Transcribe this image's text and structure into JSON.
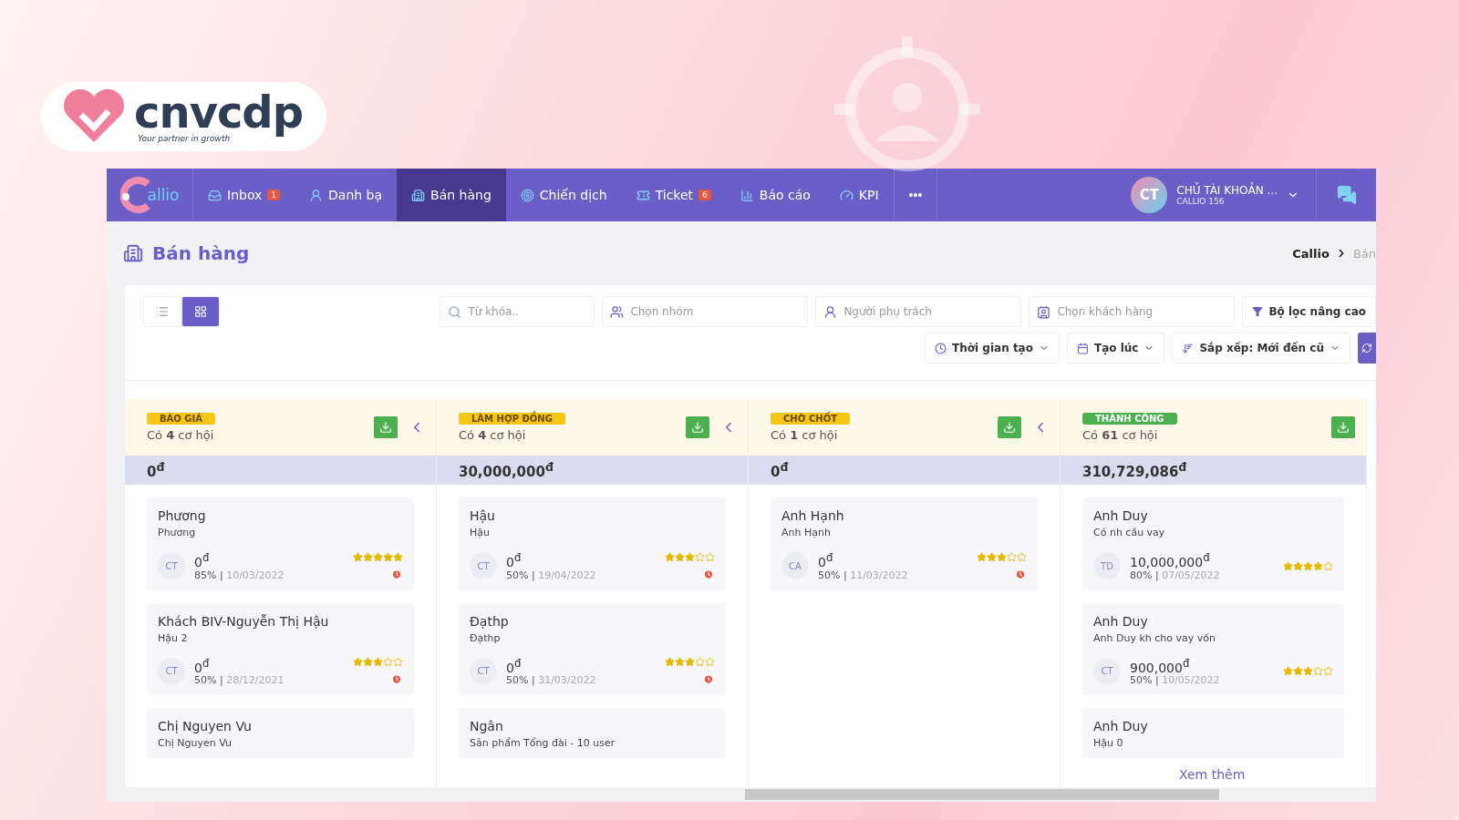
{
  "brand": {
    "name": "cnvcdp",
    "tagline": "Your partner in growth"
  },
  "nav": {
    "logo": "allio",
    "items": [
      {
        "label": "Inbox",
        "badge": "1",
        "selected": false
      },
      {
        "label": "Danh bạ",
        "selected": false
      },
      {
        "label": "Bán hàng",
        "selected": true
      },
      {
        "label": "Chiến dịch",
        "selected": false
      },
      {
        "label": "Ticket",
        "badge": "6",
        "selected": false
      },
      {
        "label": "Báo cáo",
        "selected": false
      },
      {
        "label": "KPI",
        "selected": false
      }
    ],
    "more": "•••",
    "user": {
      "initials": "CT",
      "name": "CHỦ TÀI KHOẢN ...",
      "account": "CALLIO 156"
    }
  },
  "page": {
    "title": "Bán hàng",
    "breadcrumb": [
      "Callio",
      "Bán"
    ]
  },
  "views": [
    {
      "kind": "list",
      "selected": false
    },
    {
      "kind": "board",
      "selected": true
    }
  ],
  "filters": {
    "search": {
      "placeholder": "Từ khóa.."
    },
    "group": {
      "placeholder": "Chọn nhóm"
    },
    "owner": {
      "placeholder": "Người phụ trách"
    },
    "customer": {
      "placeholder": "Chọn khách hàng"
    },
    "advanced": "Bộ lọc nâng cao",
    "dropdowns": [
      {
        "kind": "clock",
        "label": "Thời gian tạo"
      },
      {
        "kind": "calendar",
        "label": "Tạo lúc"
      },
      {
        "kind": "sort",
        "label": "Sắp xếp: Mới đến cũ"
      }
    ]
  },
  "columns": [
    {
      "stage": "BÁO GIÁ",
      "color": "#f5c518",
      "count": "Có **4** cơ hội",
      "total": "0$^{đ}$",
      "collapsible": true,
      "cards": [
        {
          "title": "Phương",
          "subtitle": "Phương",
          "avatar": "CT",
          "amount": "0$^{đ}$",
          "meta": "85% | ",
          "date": "10/03/2022",
          "stars": 5,
          "overdue": true
        },
        {
          "title": "Khách BIV-Nguyễn Thị Hậu",
          "subtitle": "Hậu 2",
          "avatar": "CT",
          "amount": "0$^{đ}$",
          "meta": "50% | ",
          "date": "28/12/2021",
          "stars": 3,
          "overdue": true
        },
        {
          "title": "Chị Nguyen Vu",
          "subtitle": "Chị Nguyen Vu"
        }
      ]
    },
    {
      "stage": "LÀM HỢP ĐỒNG",
      "color": "#f5c518",
      "count": "Có **4** cơ hội",
      "total": "30,000,000$^{đ}$",
      "collapsible": true,
      "cards": [
        {
          "title": "Hậu",
          "subtitle": "Hậu",
          "avatar": "CT",
          "amount": "0$^{đ}$",
          "meta": "50% | ",
          "date": "19/04/2022",
          "stars": 3,
          "overdue": true
        },
        {
          "title": "Đạthp",
          "subtitle": "Đạthp",
          "avatar": "CT",
          "amount": "0$^{đ}$",
          "meta": "50% | ",
          "date": "31/03/2022",
          "stars": 3,
          "overdue": true
        },
        {
          "title": "Ngân",
          "subtitle": "Sản phẩm Tổng đài - 10 user"
        }
      ]
    },
    {
      "stage": "CHỜ CHỐT",
      "color": "#f5c518",
      "count": "Có **1** cơ hội",
      "total": "0$^{đ}$",
      "collapsible": true,
      "cards": [
        {
          "title": "Anh Hạnh",
          "subtitle": "Anh Hạnh",
          "avatar": "CA",
          "amount": "0$^{đ}$",
          "meta": "50% | ",
          "date": "11/03/2022",
          "stars": 3,
          "overdue": true
        }
      ]
    },
    {
      "stage": "THÀNH CÔNG",
      "color": "#4caf50",
      "count": "Có **61** cơ hội",
      "total": "310,729,086$^{đ}$",
      "collapsible": false,
      "more": "Xem thêm",
      "cards": [
        {
          "title": "Anh Duy",
          "subtitle": "Có nh cầu vay",
          "avatar": "TD",
          "amount": "10,000,000$^{đ}$",
          "meta": "80% | ",
          "date": "07/05/2022",
          "stars": 4,
          "overdue": false
        },
        {
          "title": "Anh Duy",
          "subtitle": "Anh Duy kh cho vay vốn",
          "avatar": "CT",
          "amount": "900,000$^{đ}$",
          "meta": "50% | ",
          "date": "10/05/2022",
          "stars": 3,
          "overdue": false
        },
        {
          "title": "Anh Duy",
          "subtitle": "Hậu 0"
        }
      ]
    }
  ]
}
